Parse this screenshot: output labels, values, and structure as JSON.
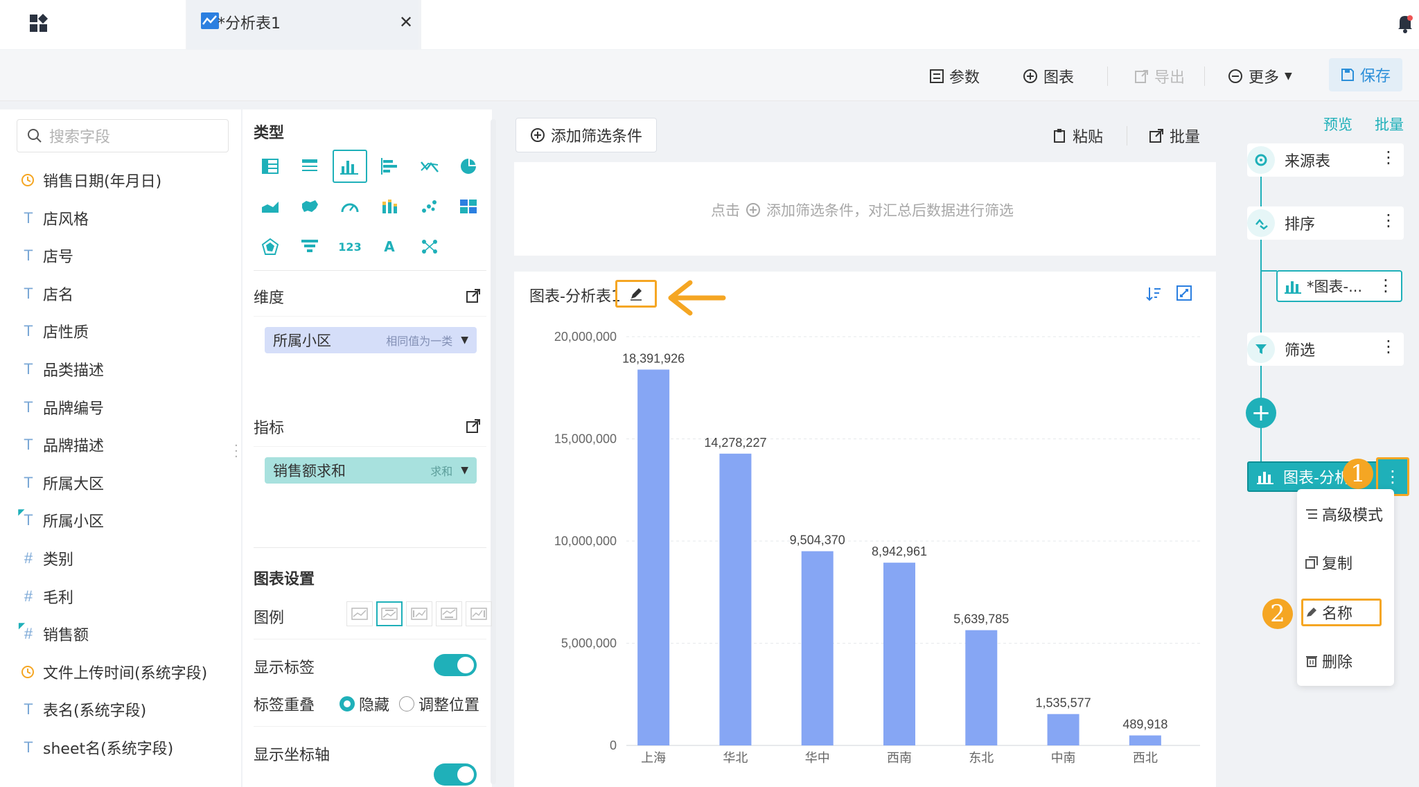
{
  "tab": {
    "title": "*分析表1"
  },
  "toolbar": {
    "params": "参数",
    "chart": "图表",
    "export": "导出",
    "more": "更多",
    "save": "保存"
  },
  "fields": {
    "search_placeholder": "搜索字段",
    "items": [
      {
        "type": "date",
        "label": "销售日期(年月日)"
      },
      {
        "type": "text",
        "label": "店风格"
      },
      {
        "type": "text",
        "label": "店号"
      },
      {
        "type": "text",
        "label": "店名"
      },
      {
        "type": "text",
        "label": "店性质"
      },
      {
        "type": "text",
        "label": "品类描述"
      },
      {
        "type": "text",
        "label": "品牌编号"
      },
      {
        "type": "text",
        "label": "品牌描述"
      },
      {
        "type": "text",
        "label": "所属大区"
      },
      {
        "type": "text-used",
        "label": "所属小区"
      },
      {
        "type": "number",
        "label": "类别"
      },
      {
        "type": "number",
        "label": "毛利"
      },
      {
        "type": "number-used",
        "label": "销售额"
      },
      {
        "type": "date",
        "label": "文件上传时间(系统字段)"
      },
      {
        "type": "text",
        "label": "表名(系统字段)"
      },
      {
        "type": "text",
        "label": "sheet名(系统字段)"
      }
    ]
  },
  "config": {
    "type_title": "类型",
    "dimension_title": "维度",
    "dimension_pill": {
      "label": "所属小区",
      "hint": "相同值为一类"
    },
    "measure_title": "指标",
    "measure_pill": {
      "label": "销售额求和",
      "hint": "求和"
    },
    "chart_settings_title": "图表设置",
    "legend_label": "图例",
    "show_labels": "显示标签",
    "show_labels_on": true,
    "label_overlap": "标签重叠",
    "overlap_hide": "隐藏",
    "overlap_adjust": "调整位置",
    "overlap_selected": "hide",
    "show_axis": "显示坐标轴",
    "show_axis_on": true
  },
  "filter": {
    "add_button": "添加筛选条件",
    "paste": "粘贴",
    "batch": "批量",
    "hint_prefix": "点击",
    "hint_suffix": "添加筛选条件，对汇总后数据进行筛选"
  },
  "chart_title": "图表-分析表1",
  "chart_data": {
    "type": "bar",
    "categories": [
      "上海",
      "华北",
      "华中",
      "西南",
      "东北",
      "中南",
      "西北"
    ],
    "values": [
      18391926,
      14278227,
      9504370,
      8942961,
      5639785,
      1535577,
      489918
    ],
    "value_labels": [
      "18,391,926",
      "14,278,227",
      "9,504,370",
      "8,942,961",
      "5,639,785",
      "1,535,577",
      "489,918"
    ],
    "yticks": [
      0,
      5000000,
      10000000,
      15000000,
      20000000
    ],
    "ytick_labels": [
      "0",
      "5,000,000",
      "10,000,000",
      "15,000,000",
      "20,000,000"
    ],
    "ylim": [
      0,
      20000000
    ],
    "color": "#86a6f4",
    "title": "图表-分析表1",
    "xlabel": "",
    "ylabel": ""
  },
  "flow": {
    "preview": "预览",
    "batch": "批量",
    "nodes": [
      "来源表",
      "排序",
      "*图表-...",
      "筛选"
    ],
    "active_node": "图表-分析",
    "menu": [
      "高级模式",
      "复制",
      "名称",
      "删除"
    ],
    "badges": [
      "1",
      "2"
    ]
  },
  "colors": {
    "accent": "#1fb0b9",
    "highlight": "#f5a623",
    "bar": "#86a6f4",
    "save": "#2c8fd9"
  }
}
